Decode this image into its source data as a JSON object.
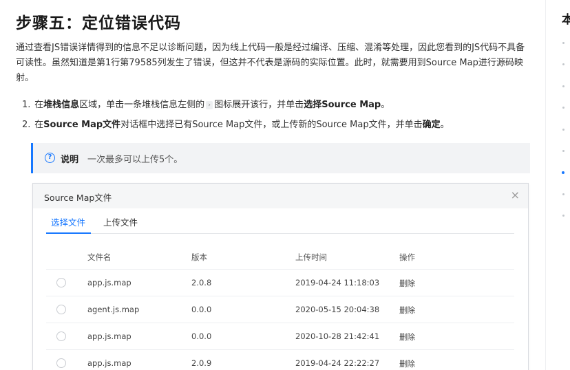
{
  "page": {
    "title": "步骤五：定位错误代码",
    "intro": "通过查看JS错误详情得到的信息不足以诊断问题，因为线上代码一般是经过编译、压缩、混淆等处理，因此您看到的JS代码不具备可读性。虽然知道是第1行第79585列发生了错误，但这并不代表是源码的实际位置。此时，就需要用到Source Map进行源码映射。"
  },
  "steps": [
    {
      "num": "1.",
      "p1": "在",
      "b1": "堆栈信息",
      "p2": "区域，单击一条堆栈信息左侧的",
      "icon": "chevron-right-icon",
      "p3": "图标展开该行，并单击",
      "b2": "选择Source Map",
      "p4": "。"
    },
    {
      "num": "2.",
      "p1": "在",
      "b1": "Source Map文件",
      "p2": "对话框中选择已有Source Map文件，或上传新的Source Map文件，并单击",
      "b2": "确定",
      "p3": "。"
    }
  ],
  "note": {
    "icon": "question-circle-icon",
    "label": "说明",
    "text": "一次最多可以上传5个。",
    "accent": "#1677ff"
  },
  "dialog": {
    "title": "Source Map文件",
    "close_icon": "close-icon",
    "tabs": [
      {
        "label": "选择文件",
        "active": true
      },
      {
        "label": "上传文件",
        "active": false
      }
    ],
    "columns": [
      "文件名",
      "版本",
      "上传时间",
      "操作"
    ],
    "rows": [
      {
        "name": "app.js.map",
        "version": "2.0.8",
        "time": "2019-04-24 11:18:03",
        "action": "删除"
      },
      {
        "name": "agent.js.map",
        "version": "0.0.0",
        "time": "2020-05-15 20:04:38",
        "action": "删除"
      },
      {
        "name": "app.js.map",
        "version": "0.0.0",
        "time": "2020-10-28 21:42:41",
        "action": "删除"
      },
      {
        "name": "app.js.map",
        "version": "2.0.9",
        "time": "2019-04-24 22:22:27",
        "action": "删除"
      }
    ]
  },
  "toc": {
    "title": "本",
    "active_index": 6,
    "item_count": 9
  }
}
